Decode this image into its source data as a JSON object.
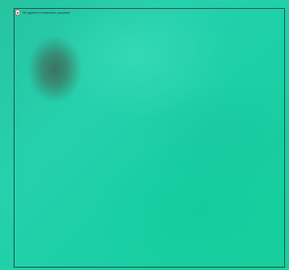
{
  "image": {
    "alt_text": "Не удается отобразить рисунок.",
    "icon": "broken-image-icon"
  },
  "colors": {
    "background": "#1fcaa6",
    "frame": "#2a4b44"
  }
}
